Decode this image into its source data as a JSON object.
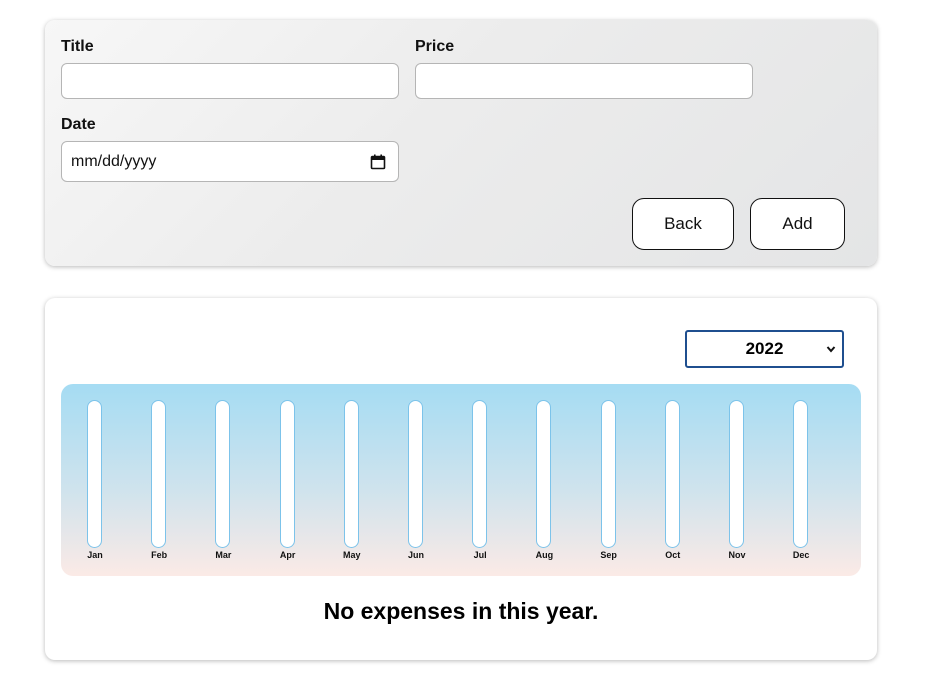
{
  "form": {
    "title_label": "Title",
    "title_value": "",
    "price_label": "Price",
    "price_value": "",
    "date_label": "Date",
    "date_placeholder": "mm/dd/yyyy",
    "back_label": "Back",
    "add_label": "Add"
  },
  "filter": {
    "selected_year": "2022"
  },
  "chart_data": {
    "type": "bar",
    "categories": [
      "Jan",
      "Feb",
      "Mar",
      "Apr",
      "May",
      "Jun",
      "Jul",
      "Aug",
      "Sep",
      "Oct",
      "Nov",
      "Dec"
    ],
    "values": [
      0,
      0,
      0,
      0,
      0,
      0,
      0,
      0,
      0,
      0,
      0,
      0
    ],
    "title": "",
    "xlabel": "",
    "ylabel": "",
    "grid": false
  },
  "empty_message": "No expenses in this year.",
  "colors": {
    "select_border": "#1f4f8f",
    "chart_gradient_top": "#a5dcf3",
    "chart_gradient_bottom": "#fbeae6",
    "bar_border": "#7cc3ea"
  }
}
